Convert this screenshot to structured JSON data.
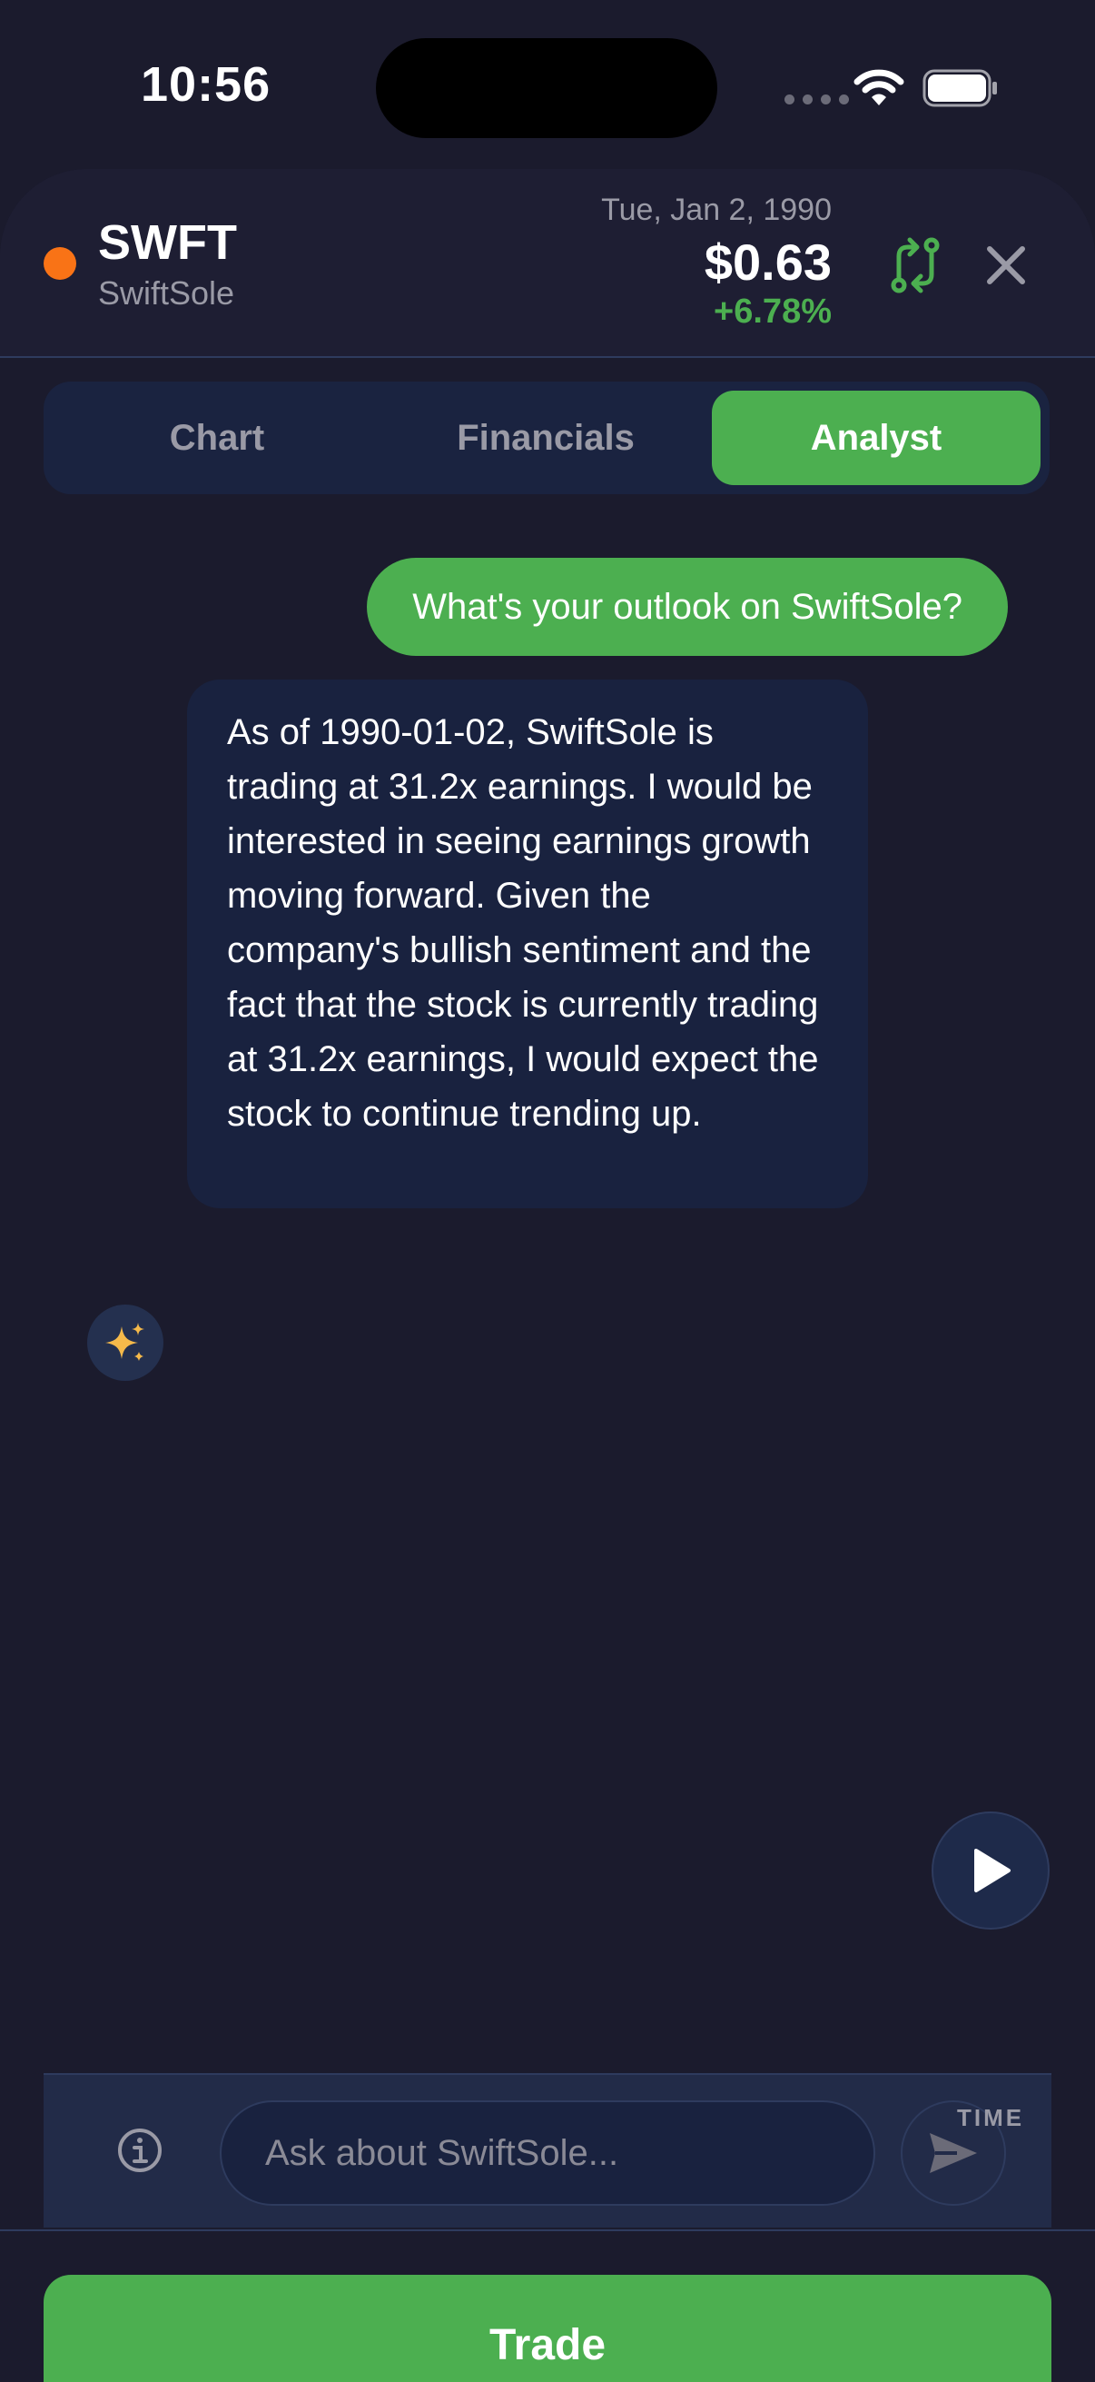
{
  "status_bar": {
    "time": "10:56"
  },
  "header": {
    "ticker": "SWFT",
    "company": "SwiftSole",
    "date": "Tue, Jan 2, 1990",
    "price": "$0.63",
    "change": "+6.78%",
    "ticker_color": "#f97316",
    "change_color": "#4caf50"
  },
  "tabs": [
    {
      "label": "Chart",
      "active": false
    },
    {
      "label": "Financials",
      "active": false
    },
    {
      "label": "Analyst",
      "active": true
    }
  ],
  "chat": {
    "user_message": "What's your outlook on SwiftSole?",
    "ai_message": "As of 1990-01-02, SwiftSole is trading at 31.2x earnings. I would be interested in seeing earnings growth moving forward. Given the company's bullish sentiment and the fact that the stock is currently trading at 31.2x earnings, I would expect the stock to continue trending up.",
    "avatar_icon": "sparkles-icon"
  },
  "input": {
    "placeholder": "Ask about SwiftSole...",
    "value": ""
  },
  "controls": {
    "time_label": "TIME",
    "play_icon": "play-icon",
    "send_icon": "send-icon",
    "info_icon": "info-icon"
  },
  "trade_button": {
    "label": "Trade"
  },
  "colors": {
    "accent": "#4caf50",
    "background": "#1b1b2d",
    "bubble": "#19223f"
  }
}
